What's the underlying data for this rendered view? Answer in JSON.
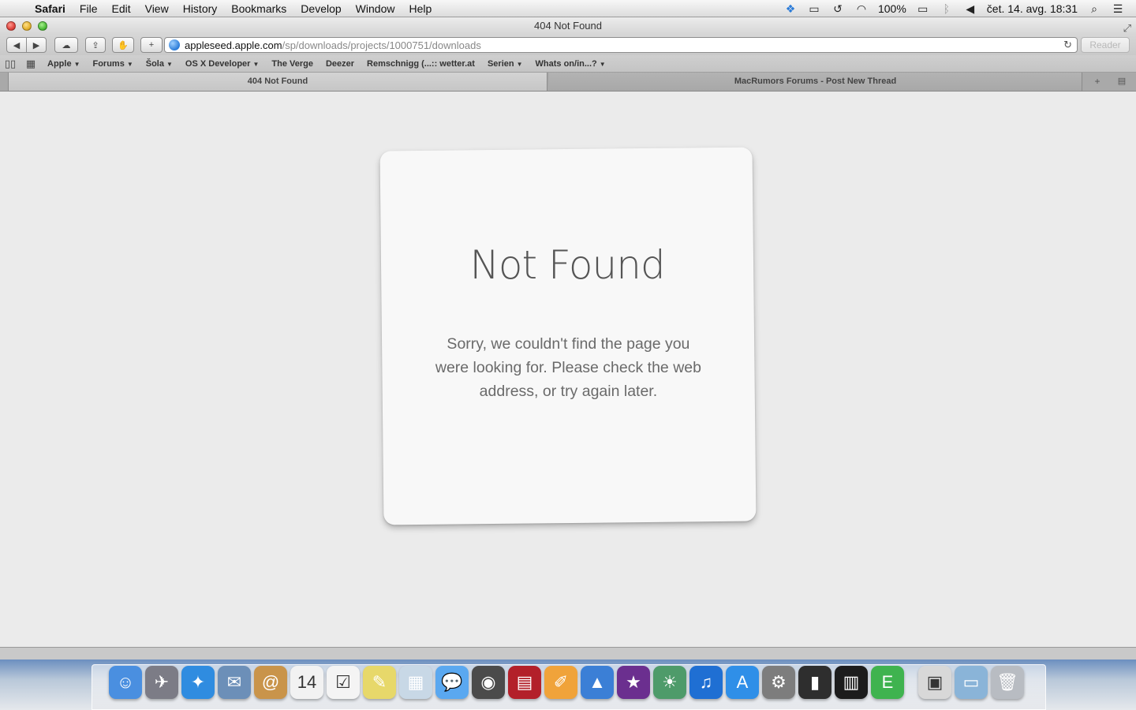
{
  "menubar": {
    "app": "Safari",
    "items": [
      "File",
      "Edit",
      "View",
      "History",
      "Bookmarks",
      "Develop",
      "Window",
      "Help"
    ],
    "battery": "100%",
    "datetime": "čet. 14. avg.  18:31"
  },
  "window": {
    "title": "404 Not Found"
  },
  "toolbar": {
    "url_host": "appleseed.apple.com",
    "url_path": "/sp/downloads/projects/1000751/downloads",
    "reader_label": "Reader"
  },
  "bookmarks": [
    {
      "label": "Apple",
      "menu": true
    },
    {
      "label": "Forums",
      "menu": true
    },
    {
      "label": "Šola",
      "menu": true
    },
    {
      "label": "OS X Developer",
      "menu": true
    },
    {
      "label": "The Verge",
      "menu": false
    },
    {
      "label": "Deezer",
      "menu": false
    },
    {
      "label": "Remschnigg (...:: wetter.at",
      "menu": false
    },
    {
      "label": "Serien",
      "menu": true
    },
    {
      "label": "Whats on/in...?",
      "menu": true
    }
  ],
  "tabs": [
    {
      "label": "404 Not Found",
      "active": true
    },
    {
      "label": "MacRumors Forums - Post New Thread",
      "active": false
    }
  ],
  "page": {
    "heading": "Not Found",
    "message": "Sorry, we couldn't find the page you were looking for. Please check the web address, or try again later."
  },
  "dock": [
    {
      "name": "finder-icon",
      "glyph": "☺",
      "color": "#4a8fe0"
    },
    {
      "name": "launchpad-icon",
      "glyph": "✈",
      "color": "#7c7c86"
    },
    {
      "name": "safari-icon",
      "glyph": "✦",
      "color": "#2f8ce0"
    },
    {
      "name": "mail-icon",
      "glyph": "✉",
      "color": "#6c8fb8"
    },
    {
      "name": "contacts-icon",
      "glyph": "@",
      "color": "#c9944a"
    },
    {
      "name": "calendar-icon",
      "glyph": "14",
      "color": "#f2f2f2"
    },
    {
      "name": "reminders-icon",
      "glyph": "☑",
      "color": "#f4f4f4"
    },
    {
      "name": "notes-icon",
      "glyph": "✎",
      "color": "#e7d86a"
    },
    {
      "name": "preview-icon",
      "glyph": "▦",
      "color": "#c8d8e6"
    },
    {
      "name": "messages-icon",
      "glyph": "💬",
      "color": "#5aa8f0"
    },
    {
      "name": "facetime-icon",
      "glyph": "◉",
      "color": "#4b4b4b"
    },
    {
      "name": "photobooth-icon",
      "glyph": "▤",
      "color": "#b3202a"
    },
    {
      "name": "pages-icon",
      "glyph": "✐",
      "color": "#f0a33a"
    },
    {
      "name": "keynote-icon",
      "glyph": "▲",
      "color": "#3b7fd6"
    },
    {
      "name": "imovie-icon",
      "glyph": "★",
      "color": "#6b2f8f"
    },
    {
      "name": "iphoto-icon",
      "glyph": "☀",
      "color": "#4e9b6a"
    },
    {
      "name": "itunes-icon",
      "glyph": "♫",
      "color": "#1f6fd3"
    },
    {
      "name": "appstore-icon",
      "glyph": "A",
      "color": "#2f8fe8"
    },
    {
      "name": "system-preferences-icon",
      "glyph": "⚙",
      "color": "#7d7d7d"
    },
    {
      "name": "battery-monitor-icon",
      "glyph": "▮",
      "color": "#2e2e2e"
    },
    {
      "name": "deezer-icon",
      "glyph": "▥",
      "color": "#1c1c1c"
    },
    {
      "name": "evernote-icon",
      "glyph": "E",
      "color": "#3fb34f"
    },
    {
      "name": "photos-folder-icon",
      "glyph": "▣",
      "color": "#d8d8d8"
    },
    {
      "name": "downloads-folder-icon",
      "glyph": "▭",
      "color": "#8ab4d8"
    },
    {
      "name": "trash-icon",
      "glyph": "🗑",
      "color": "#b8bcc2"
    }
  ]
}
